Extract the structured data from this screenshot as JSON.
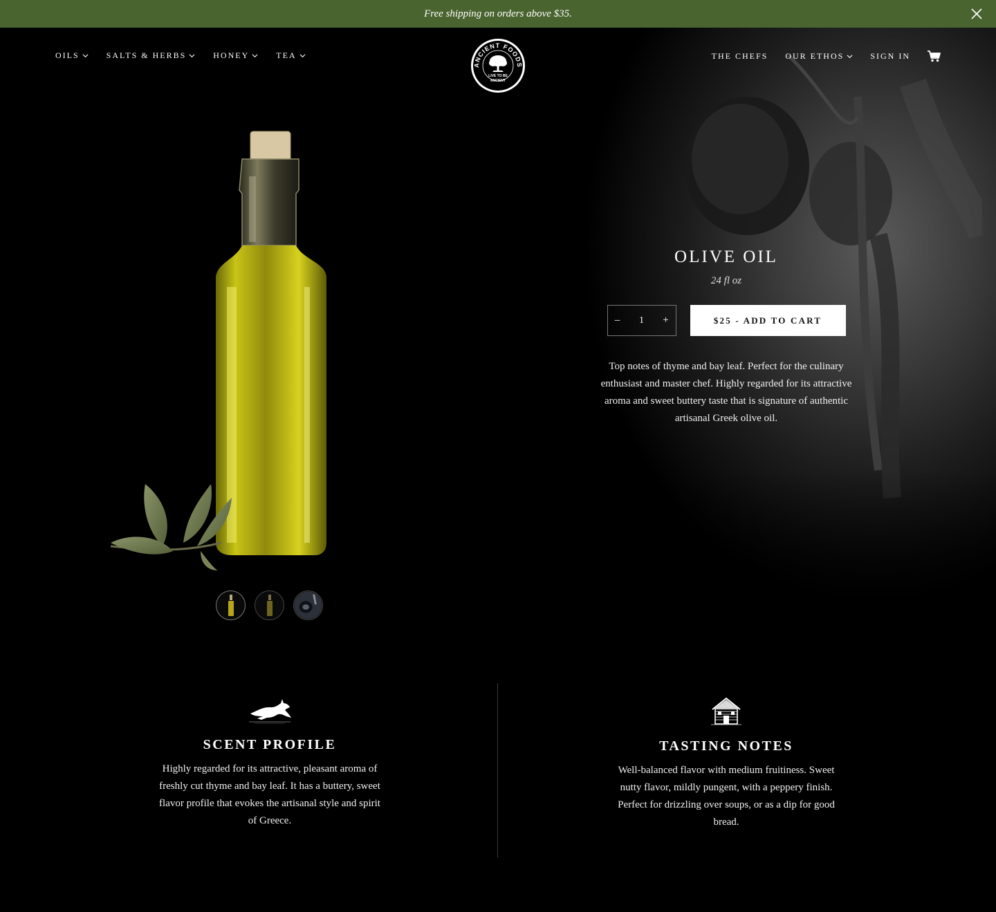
{
  "announcement": {
    "text": "Free shipping on orders above $35.",
    "close_icon": "close-icon"
  },
  "nav": {
    "left": [
      {
        "label": "OILS",
        "has_dropdown": true
      },
      {
        "label": "SALTS & HERBS",
        "has_dropdown": true
      },
      {
        "label": "HONEY",
        "has_dropdown": true
      },
      {
        "label": "TEA",
        "has_dropdown": true
      }
    ],
    "right": [
      {
        "label": "THE CHEFS",
        "has_dropdown": false
      },
      {
        "label": "OUR ETHOS",
        "has_dropdown": true
      },
      {
        "label": "SIGN IN",
        "has_dropdown": false
      }
    ],
    "cart_icon": "shopping-cart-icon"
  },
  "logo": {
    "brand": "ANCIENT FOODS",
    "tagline_top": "LIVE TO BE",
    "tagline_bottom": "ANCIENT"
  },
  "product": {
    "title": "OLIVE OIL",
    "size": "24 fl oz",
    "quantity": "1",
    "qty_minus": "–",
    "qty_plus": "+",
    "add_to_cart": "$25 - ADD TO CART",
    "description": "Top notes of thyme and bay leaf. Perfect for the culinary enthusiast and master chef. Highly regarded for its attractive aroma and sweet buttery taste that is signature of authentic artisanal Greek olive oil.",
    "thumbnails": [
      "olive-oil-bottle",
      "olive-oil-bottle-dark",
      "olive-oil-pour"
    ],
    "active_thumbnail": 0
  },
  "features": [
    {
      "icon": "hare-icon",
      "title": "SCENT PROFILE",
      "text": "Highly regarded for its attractive, pleasant aroma of freshly cut thyme and bay leaf. It has a buttery, sweet flavor profile that evokes the artisanal style and spirit of Greece."
    },
    {
      "icon": "farmhouse-icon",
      "title": "TASTING NOTES",
      "text": "Well-balanced flavor with medium fruitiness. Sweet nutty flavor, mildly pungent, with a peppery finish. Perfect for drizzling over soups, or as a dip for good bread."
    }
  ],
  "colors": {
    "announcement_bg": "#4a6430",
    "page_bg": "#000000",
    "button_bg": "#ffffff",
    "button_text": "#111111"
  }
}
